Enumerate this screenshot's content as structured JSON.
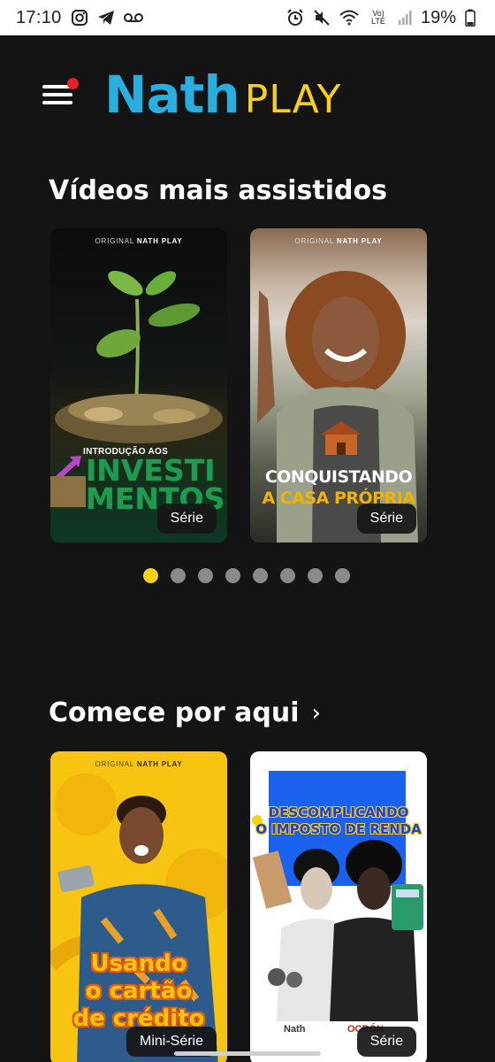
{
  "status_bar": {
    "time": "17:10",
    "battery": "19%",
    "network": "Vo) LTE",
    "icons": [
      "instagram-icon",
      "telegram-icon",
      "voicemail-icon",
      "alarm-icon",
      "mute-icon",
      "wifi-icon",
      "signal-icon",
      "battery-icon"
    ]
  },
  "header": {
    "logo_part1": "Nath",
    "logo_part2": "PLAY",
    "menu_icon": "hamburger-menu-icon",
    "notification_color": "#e8202a"
  },
  "colors": {
    "background": "#141414",
    "accent_yellow": "#f7d117",
    "brand_blue": "#29aee0"
  },
  "most_watched": {
    "title": "Vídeos mais assistidos",
    "cards": [
      {
        "original_label": "ORIGINAL",
        "original_brand": "NATH PLAY",
        "title_small": "INTRODUÇÃO AOS",
        "title_line1": "INVESTI",
        "title_line2": "MENTOS",
        "badge": "Série"
      },
      {
        "original_label": "ORIGINAL",
        "original_brand": "NATH PLAY",
        "title_line1": "CONQUISTANDO",
        "title_line2": "A CASA PRÓPRIA",
        "badge": "Série"
      }
    ],
    "dots_total": 8,
    "dots_active": 1
  },
  "start_here": {
    "title": "Comece por aqui",
    "chevron": "›",
    "cards": [
      {
        "original_label": "ORIGINAL",
        "original_brand": "NATH PLAY",
        "title_line1": "Usando",
        "title_line2": "o cartão",
        "title_line3": "de crédito",
        "badge": "Mini-Série"
      },
      {
        "title_line1": "DESCOMPLICANDO",
        "title_line2": "O IMPOSTO DE RENDA",
        "brand1": "Nath",
        "brand2": "OCRÓN",
        "badge": "Série"
      }
    ]
  }
}
